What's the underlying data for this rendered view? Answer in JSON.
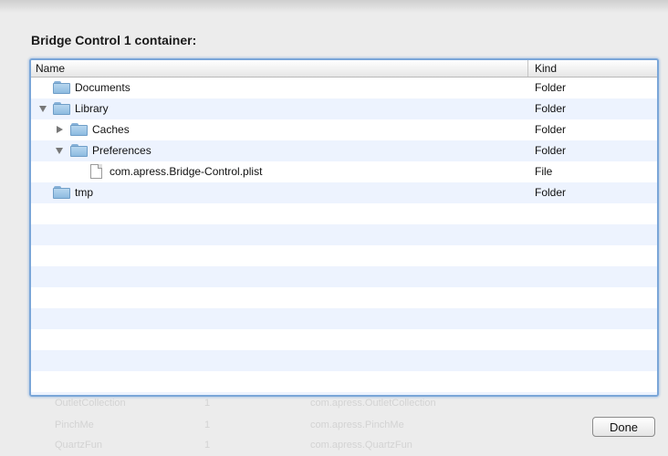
{
  "sheet": {
    "title": "Bridge Control 1 container:"
  },
  "browser": {
    "columns": {
      "name": "Name",
      "kind": "Kind"
    },
    "rows": [
      {
        "name": "Documents",
        "kind": "Folder"
      },
      {
        "name": "Library",
        "kind": "Folder"
      },
      {
        "name": "Caches",
        "kind": "Folder"
      },
      {
        "name": "Preferences",
        "kind": "Folder"
      },
      {
        "name": "com.apress.Bridge-Control.plist",
        "kind": "File"
      },
      {
        "name": "tmp",
        "kind": "Folder"
      }
    ]
  },
  "background": {
    "rows": [
      {
        "c1": "OutletCollection",
        "c2": "1",
        "c3": "com.apress.OutletCollection"
      },
      {
        "c1": "PinchMe",
        "c2": "1",
        "c3": "com.apress.PinchMe"
      },
      {
        "c1": "QuartzFun",
        "c2": "1",
        "c3": "com.apress.QuartzFun"
      }
    ]
  },
  "buttons": {
    "done": "Done"
  },
  "colors": {
    "focus_ring": "#7aa6d8",
    "stripe": "#edf3fe",
    "folder": "#9cc6ea"
  }
}
